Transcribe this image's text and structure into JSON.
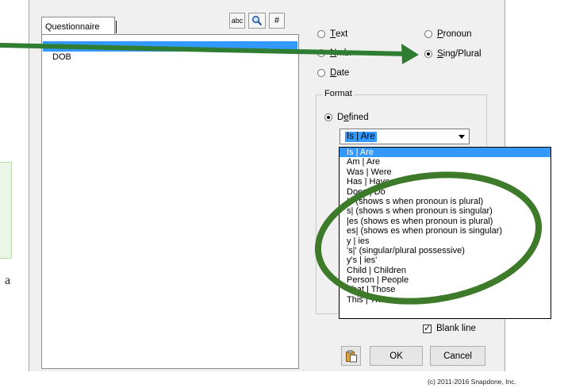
{
  "left_panel": {
    "tab_label": "Questionnaire",
    "toolbar": {
      "spell_label": "abc",
      "search_icon": "magnifier-icon",
      "number_label": "#"
    },
    "fields": [
      {
        "label": "",
        "selected": true
      },
      {
        "label": "DOB",
        "selected": false
      }
    ]
  },
  "page_fragment": {
    "stray_text": "a"
  },
  "type_options": {
    "text": {
      "first": "T",
      "rest": "ext",
      "selected": false
    },
    "number": {
      "first": "N",
      "rest": "mbr",
      "selected": false
    },
    "date": {
      "first": "D",
      "rest": "ate",
      "selected": false
    },
    "pronoun": {
      "first": "P",
      "rest": "ronoun",
      "selected": false
    },
    "sing_plural": {
      "first": "S",
      "rest": "ing/Plural",
      "selected": true
    }
  },
  "format_group": {
    "title": "Format",
    "defined_first": "e",
    "defined_prefix": "D",
    "defined_rest": "fined",
    "combo_value": "Is | Are",
    "options": [
      "Is | Are",
      "Am | Are",
      "Was | Were",
      "Has | Have",
      "Does | Do",
      "|s  (shows s when pronoun is plural)",
      "s|  (shows s when pronoun is singular)",
      "|es  (shows es when pronoun is plural)",
      "es|  (shows es when pronoun is singular)",
      "y | ies",
      "'s|' (singular/plural possessive)",
      "y's | ies'",
      "Child | Children",
      "Person | People",
      "That | Those",
      "This | These"
    ],
    "selected_option": "Is | Are"
  },
  "blank_line": {
    "label": "Blank line",
    "checked": true
  },
  "buttons": {
    "paste_icon": "clipboard-icon",
    "ok": "OK",
    "cancel": "Cancel"
  },
  "copyright": "(c) 2011-2016 Snapdone, Inc.",
  "colors": {
    "arrow": "#2e7d32",
    "ellipse": "#3d7a2a",
    "selection": "#3399ff",
    "dialog_bg": "#f0f0f0"
  }
}
